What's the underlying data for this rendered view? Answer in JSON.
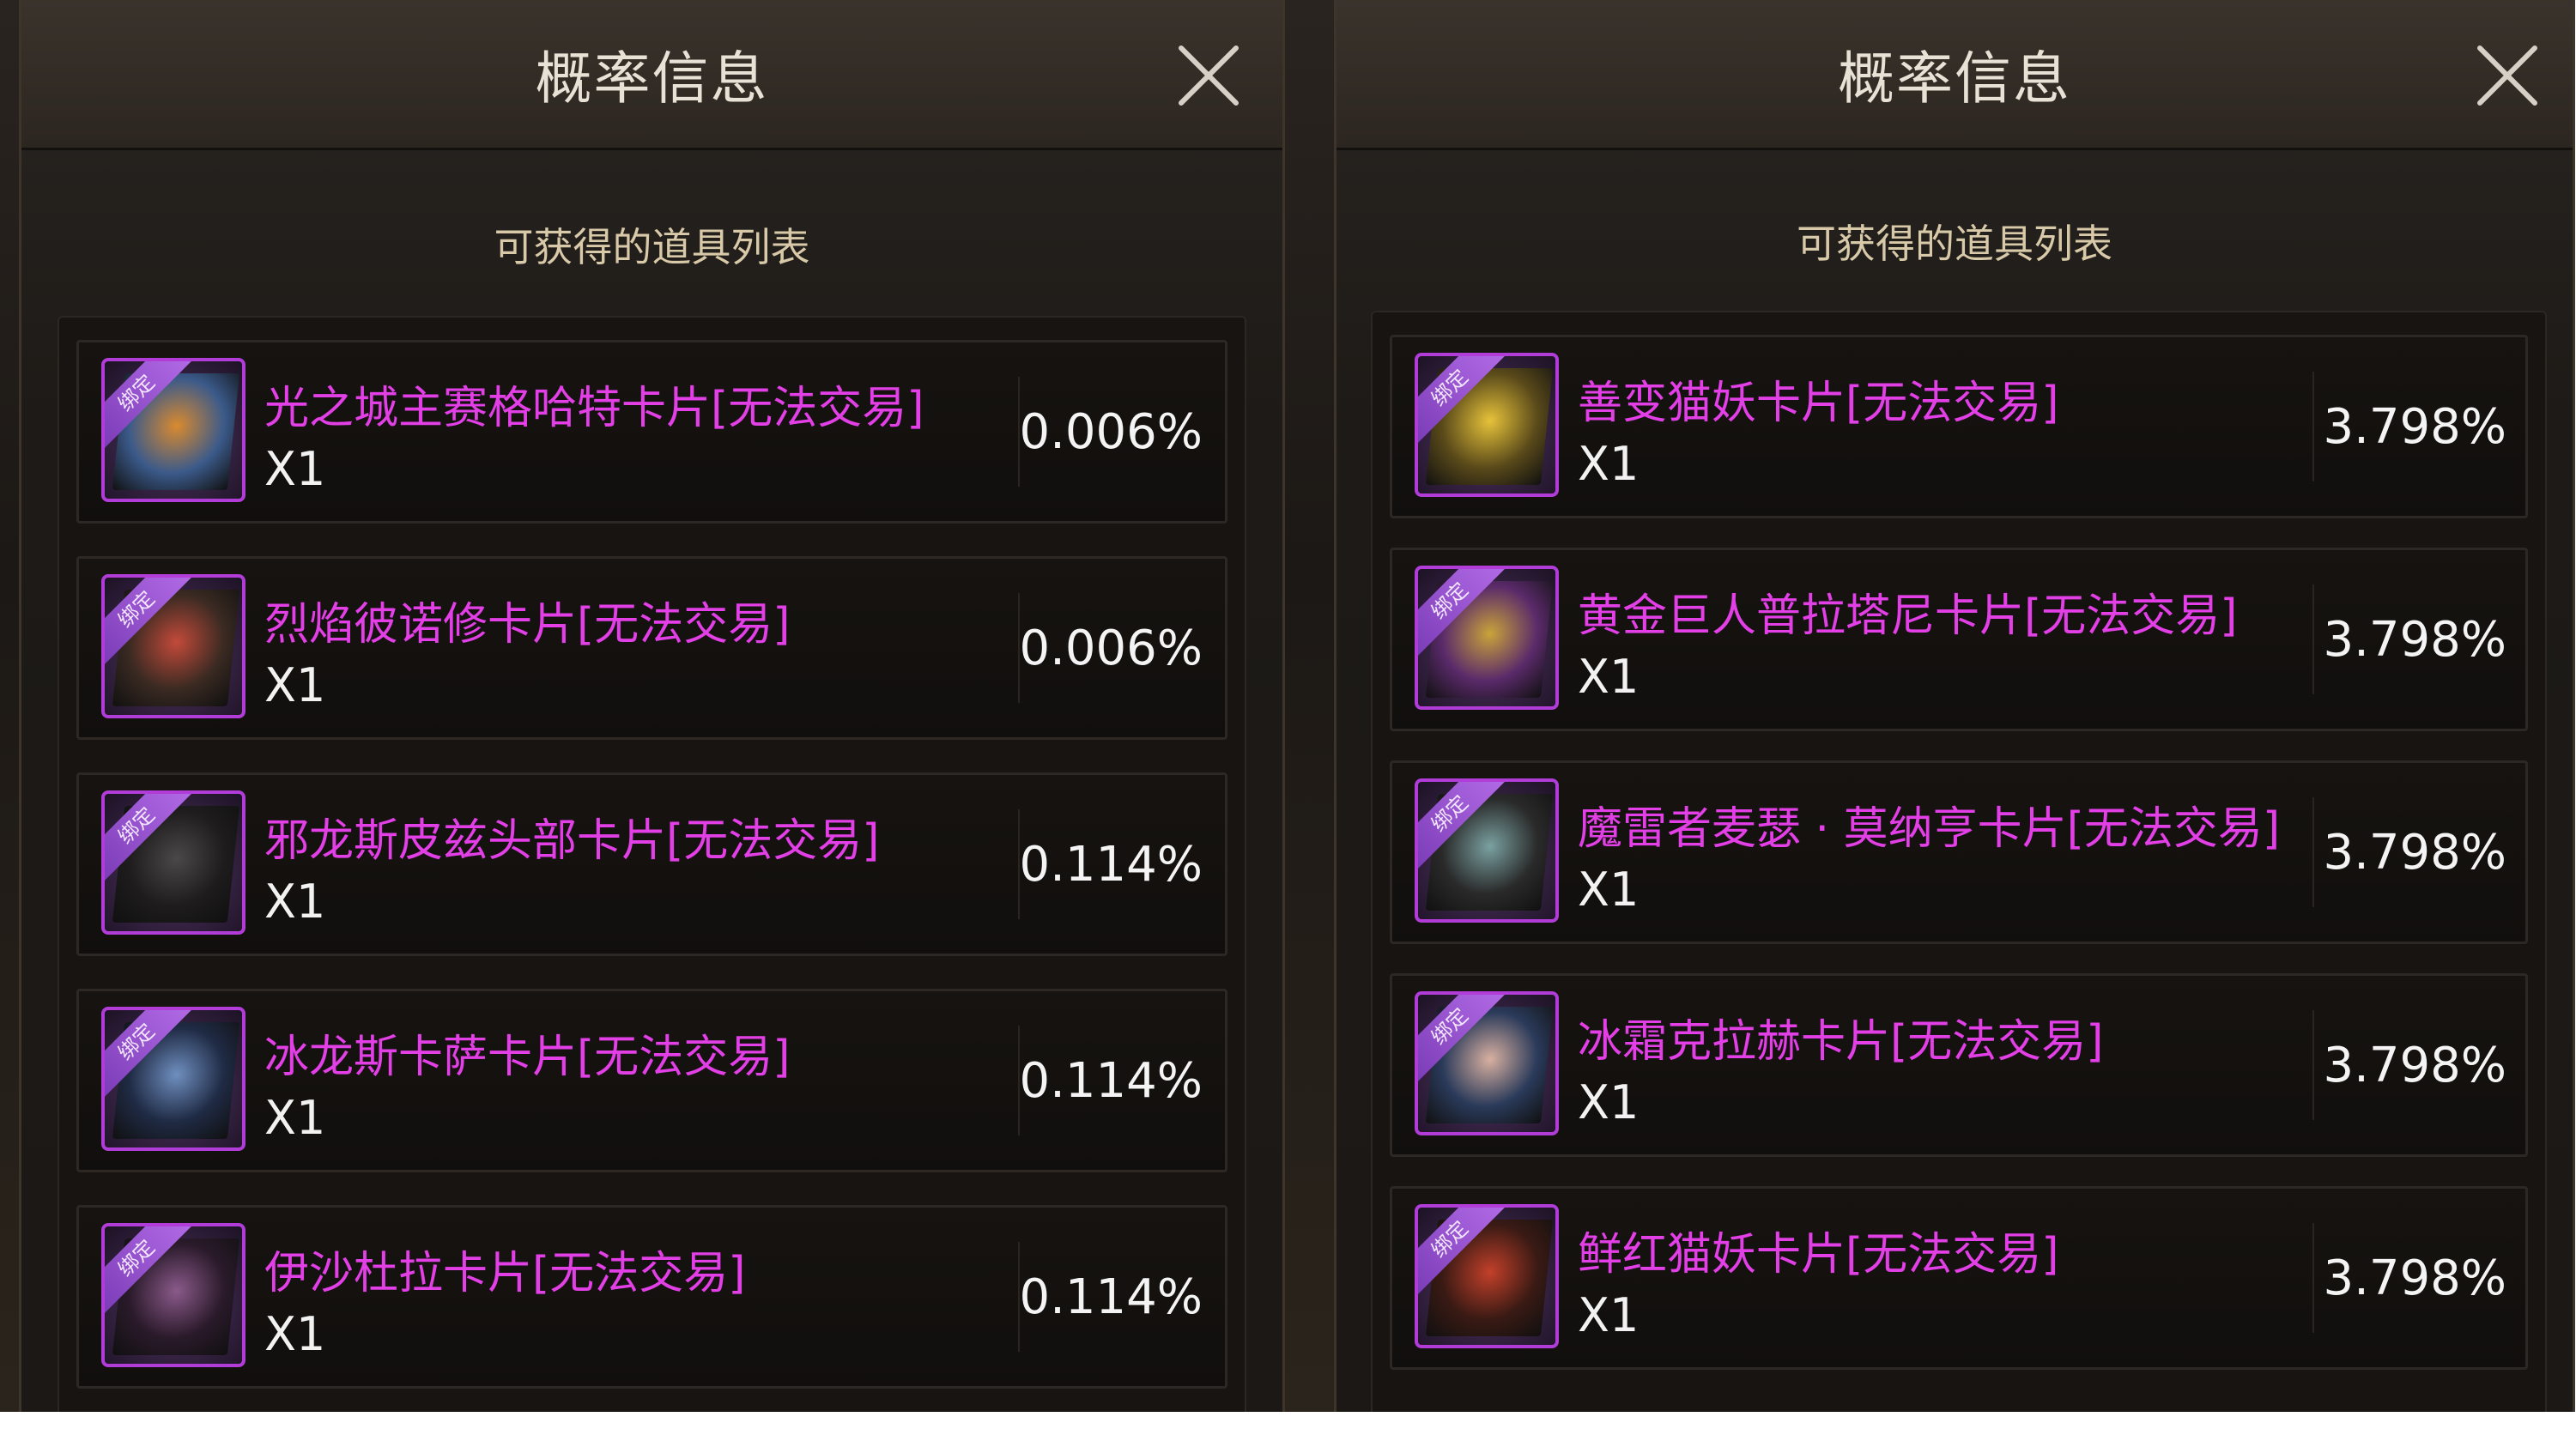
{
  "panels": [
    {
      "title": "概率信息",
      "subtitle": "可获得的道具列表",
      "items": [
        {
          "name": "光之城主赛格哈特卡片[无法交易]",
          "qty": "X1",
          "rate": "0.006%",
          "badge": "绑定",
          "icon": "helmet-card-icon",
          "art_colors": [
            "#d98a2f",
            "#3b5a8a"
          ]
        },
        {
          "name": "烈焰彼诺修卡片[无法交易]",
          "qty": "X1",
          "rate": "0.006%",
          "badge": "绑定",
          "icon": "flame-face-card-icon",
          "art_colors": [
            "#c24a3a",
            "#3a2a22"
          ]
        },
        {
          "name": "邪龙斯皮兹头部卡片[无法交易]",
          "qty": "X1",
          "rate": "0.114%",
          "badge": "绑定",
          "icon": "dragon-head-card-icon",
          "art_colors": [
            "#4a4848",
            "#1e1c1c"
          ]
        },
        {
          "name": "冰龙斯卡萨卡片[无法交易]",
          "qty": "X1",
          "rate": "0.114%",
          "badge": "绑定",
          "icon": "ice-dragon-card-icon",
          "art_colors": [
            "#6f8fbf",
            "#1f2a44"
          ]
        },
        {
          "name": "伊沙杜拉卡片[无法交易]",
          "qty": "X1",
          "rate": "0.114%",
          "badge": "绑定",
          "icon": "dark-girl-card-icon",
          "art_colors": [
            "#8a5a8a",
            "#2a1a2a"
          ]
        }
      ]
    },
    {
      "title": "概率信息",
      "subtitle": "可获得的道具列表",
      "items": [
        {
          "name": "善变猫妖卡片[无法交易]",
          "qty": "X1",
          "rate": "3.798%",
          "badge": "绑定",
          "icon": "cat-demon-card-icon",
          "art_colors": [
            "#e6c23a",
            "#5a4a1a"
          ]
        },
        {
          "name": "黄金巨人普拉塔尼卡片[无法交易]",
          "qty": "X1",
          "rate": "3.798%",
          "badge": "绑定",
          "icon": "golden-giant-card-icon",
          "art_colors": [
            "#c9a33a",
            "#5a2a6a"
          ]
        },
        {
          "name": "魔雷者麦瑟 · 莫纳亨卡片[无法交易]",
          "qty": "X1",
          "rate": "3.798%",
          "badge": "绑定",
          "icon": "hatted-man-card-icon",
          "art_colors": [
            "#7aa0a0",
            "#2a2a2a"
          ]
        },
        {
          "name": "冰霜克拉赫卡片[无法交易]",
          "qty": "X1",
          "rate": "3.798%",
          "badge": "绑定",
          "icon": "frost-woman-card-icon",
          "art_colors": [
            "#d8b0a0",
            "#2a3a5a"
          ]
        },
        {
          "name": "鲜红猫妖卡片[无法交易]",
          "qty": "X1",
          "rate": "3.798%",
          "badge": "绑定",
          "icon": "red-cat-demon-card-icon",
          "art_colors": [
            "#c2402a",
            "#3a1a14"
          ]
        }
      ]
    }
  ]
}
